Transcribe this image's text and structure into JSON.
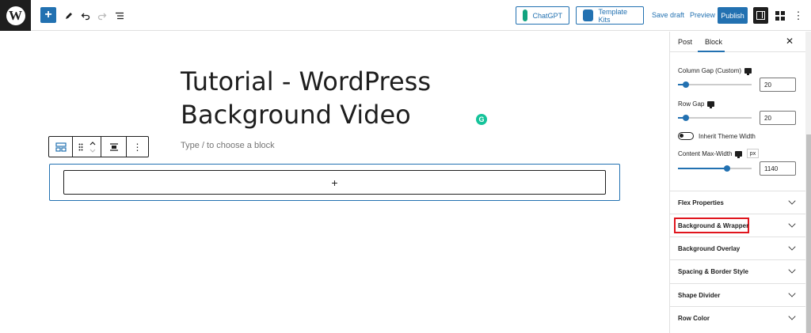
{
  "topbar": {
    "logo_glyph": "W",
    "add_glyph": "+",
    "chatgpt_label": "ChatGPT",
    "template_kits_label": "Template Kits",
    "save_draft_label": "Save draft",
    "preview_label": "Preview",
    "publish_label": "Publish",
    "more_glyph": "⋮"
  },
  "editor": {
    "title_line1": "Tutorial - WordPress",
    "title_line2": "Background Video",
    "placeholder": "Type / to choose a block",
    "appender_glyph": "+",
    "grammarly_glyph": "G"
  },
  "sidebar": {
    "tab_post": "Post",
    "tab_block": "Block",
    "close_glyph": "✕",
    "column_gap_label": "Column Gap (Custom)",
    "column_gap_value": "20",
    "row_gap_label": "Row Gap",
    "row_gap_value": "20",
    "inherit_width_label": "Inherit Theme Width",
    "content_max_width_label": "Content Max-Width",
    "unit_label": "px",
    "content_max_width_value": "1140",
    "panels": [
      "Flex Properties",
      "Background & Wrapper",
      "Background Overlay",
      "Spacing & Border Style",
      "Shape Divider",
      "Row Color"
    ]
  },
  "colors": {
    "accent": "#2271b1",
    "highlight": "#e0151d",
    "chatgpt_icon": "#10a37f"
  }
}
